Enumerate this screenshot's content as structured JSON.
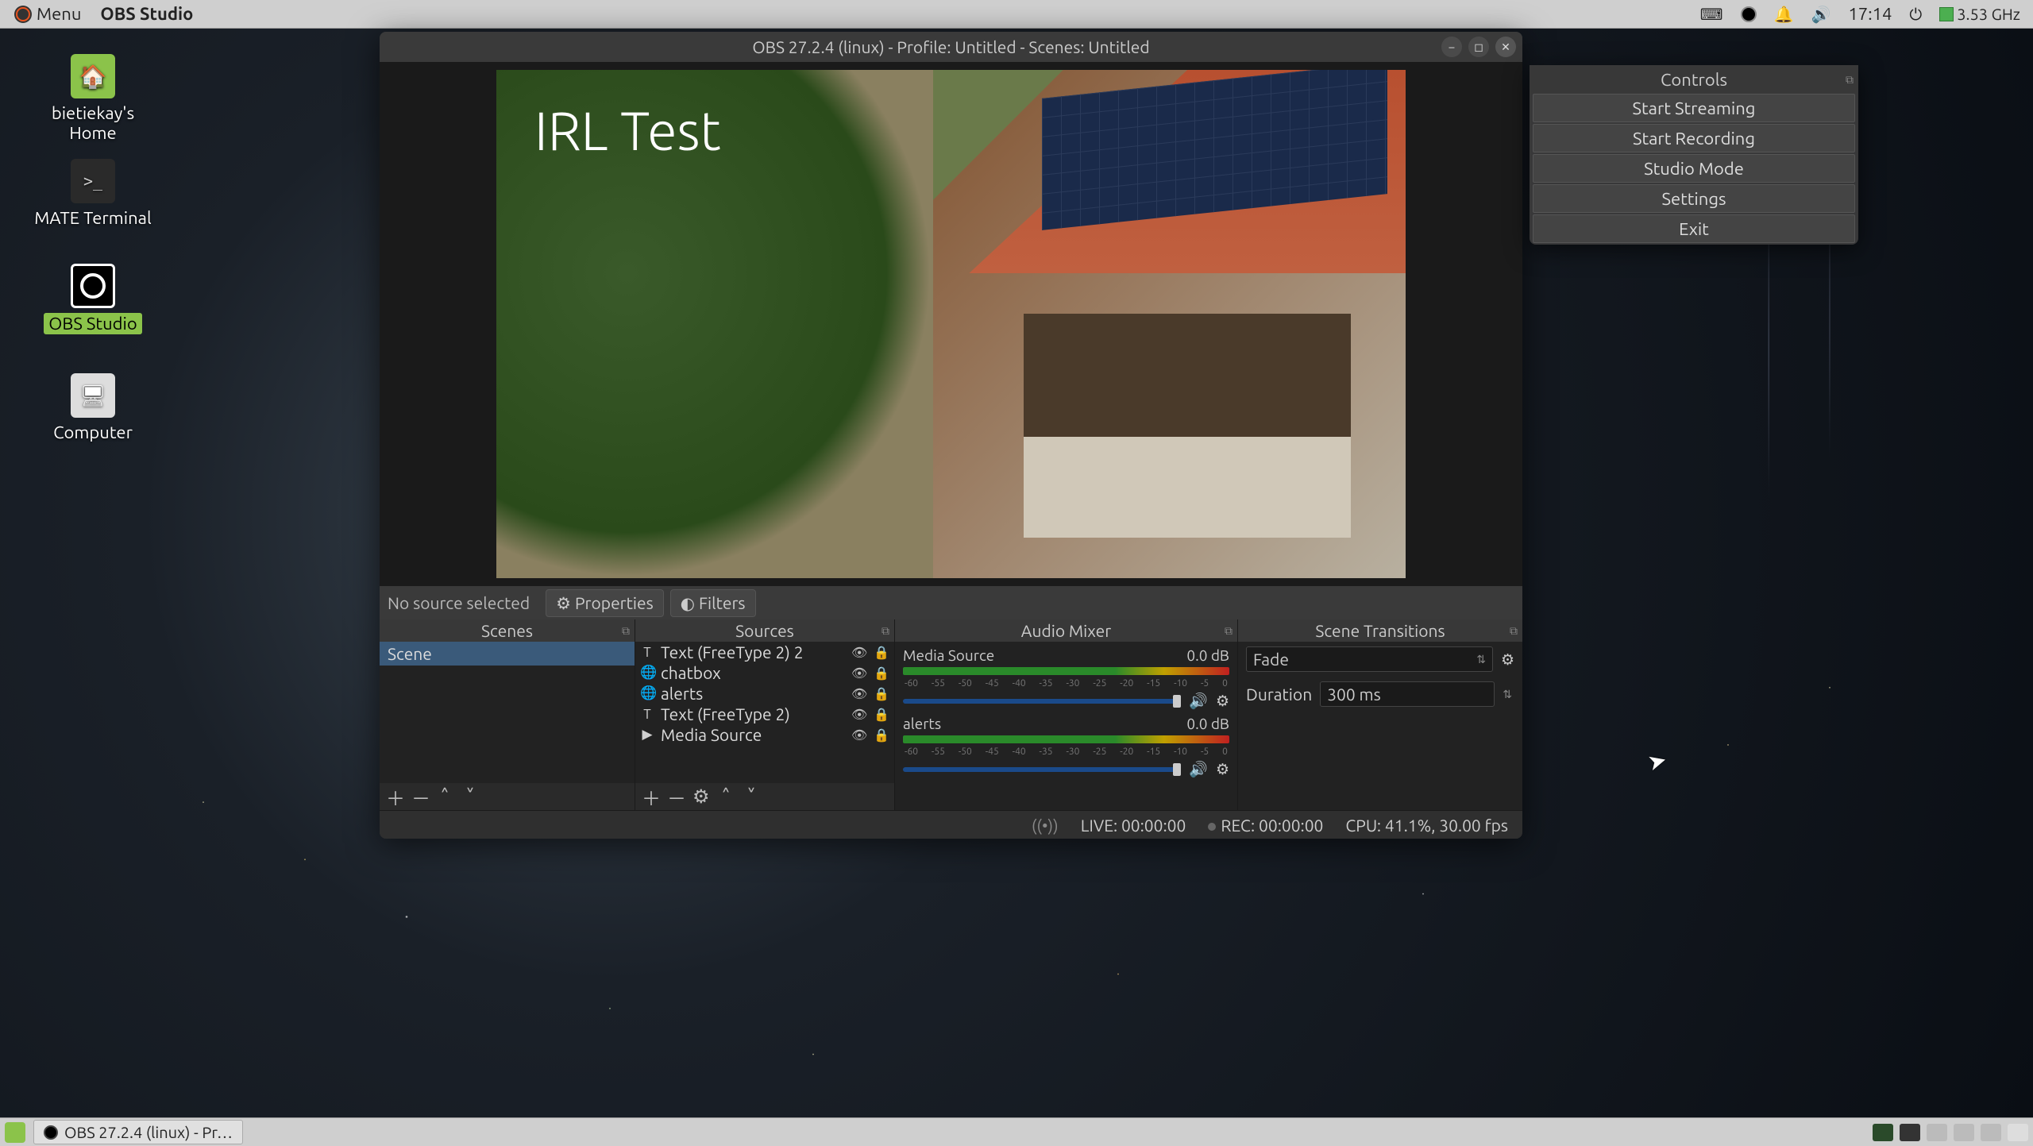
{
  "top_panel": {
    "menu_label": "Menu",
    "app_name": "OBS Studio",
    "clock": "17:14",
    "cpu_freq": "3.53 GHz"
  },
  "desktop_icons": {
    "home": "bietiekay's Home",
    "terminal": "MATE Terminal",
    "obs": "OBS Studio",
    "computer": "Computer"
  },
  "obs": {
    "title": "OBS 27.2.4 (linux) - Profile: Untitled - Scenes: Untitled",
    "preview_overlay_text": "IRL Test",
    "source_bar": {
      "status": "No source selected",
      "properties": "Properties",
      "filters": "Filters"
    },
    "panels": {
      "scenes_hdr": "Scenes",
      "sources_hdr": "Sources",
      "mixer_hdr": "Audio Mixer",
      "trans_hdr": "Scene Transitions"
    },
    "scenes": [
      "Scene"
    ],
    "sources": [
      {
        "type": "T",
        "name": "Text (FreeType 2) 2"
      },
      {
        "type": "🌐",
        "name": "chatbox"
      },
      {
        "type": "🌐",
        "name": "alerts"
      },
      {
        "type": "T",
        "name": "Text (FreeType 2)"
      },
      {
        "type": "▶",
        "name": "Media Source"
      }
    ],
    "mixer": [
      {
        "name": "Media Source",
        "level": "0.0 dB"
      },
      {
        "name": "alerts",
        "level": "0.0 dB"
      }
    ],
    "mixer_ticks": [
      "-60",
      "-55",
      "-50",
      "-45",
      "-40",
      "-35",
      "-30",
      "-25",
      "-20",
      "-15",
      "-10",
      "-5",
      "0"
    ],
    "transitions": {
      "selected": "Fade",
      "duration_label": "Duration",
      "duration_value": "300 ms"
    },
    "status": {
      "live": "LIVE: 00:00:00",
      "rec": "REC: 00:00:00",
      "cpu": "CPU: 41.1%, 30.00 fps"
    }
  },
  "controls_panel": {
    "header": "Controls",
    "buttons": [
      "Start Streaming",
      "Start Recording",
      "Studio Mode",
      "Settings",
      "Exit"
    ]
  },
  "taskbar": {
    "item": "OBS 27.2.4 (linux) - Pr…"
  }
}
